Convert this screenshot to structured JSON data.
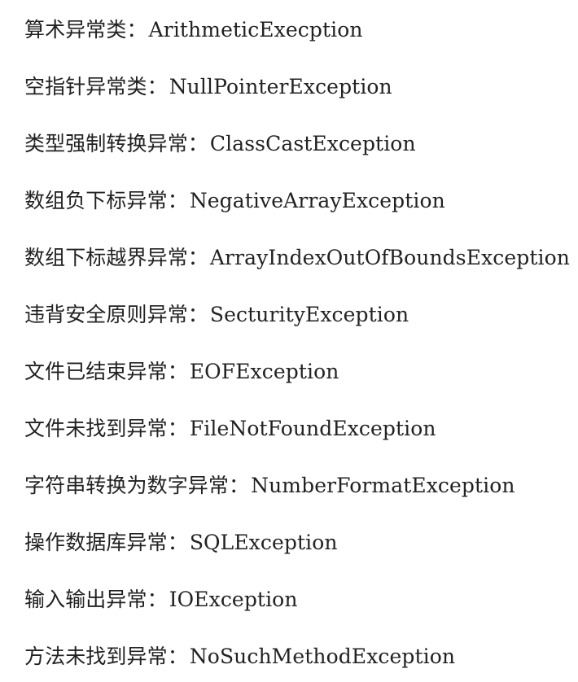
{
  "items": [
    {
      "label": "算术异常类：",
      "name": "ArithmeticExecption"
    },
    {
      "label": "空指针异常类：",
      "name": "NullPointerException"
    },
    {
      "label": "类型强制转换异常：",
      "name": "ClassCastException"
    },
    {
      "label": "数组负下标异常：",
      "name": "NegativeArrayException"
    },
    {
      "label": "数组下标越界异常：",
      "name": "ArrayIndexOutOfBoundsException"
    },
    {
      "label": "违背安全原则异常：",
      "name": "SecturityException"
    },
    {
      "label": "文件已结束异常：",
      "name": "EOFException"
    },
    {
      "label": "文件未找到异常：",
      "name": "FileNotFoundException"
    },
    {
      "label": "字符串转换为数字异常：",
      "name": "NumberFormatException"
    },
    {
      "label": "操作数据库异常：",
      "name": "SQLException"
    },
    {
      "label": "输入输出异常：",
      "name": "IOException"
    },
    {
      "label": "方法未找到异常：",
      "name": "NoSuchMethodException"
    }
  ]
}
